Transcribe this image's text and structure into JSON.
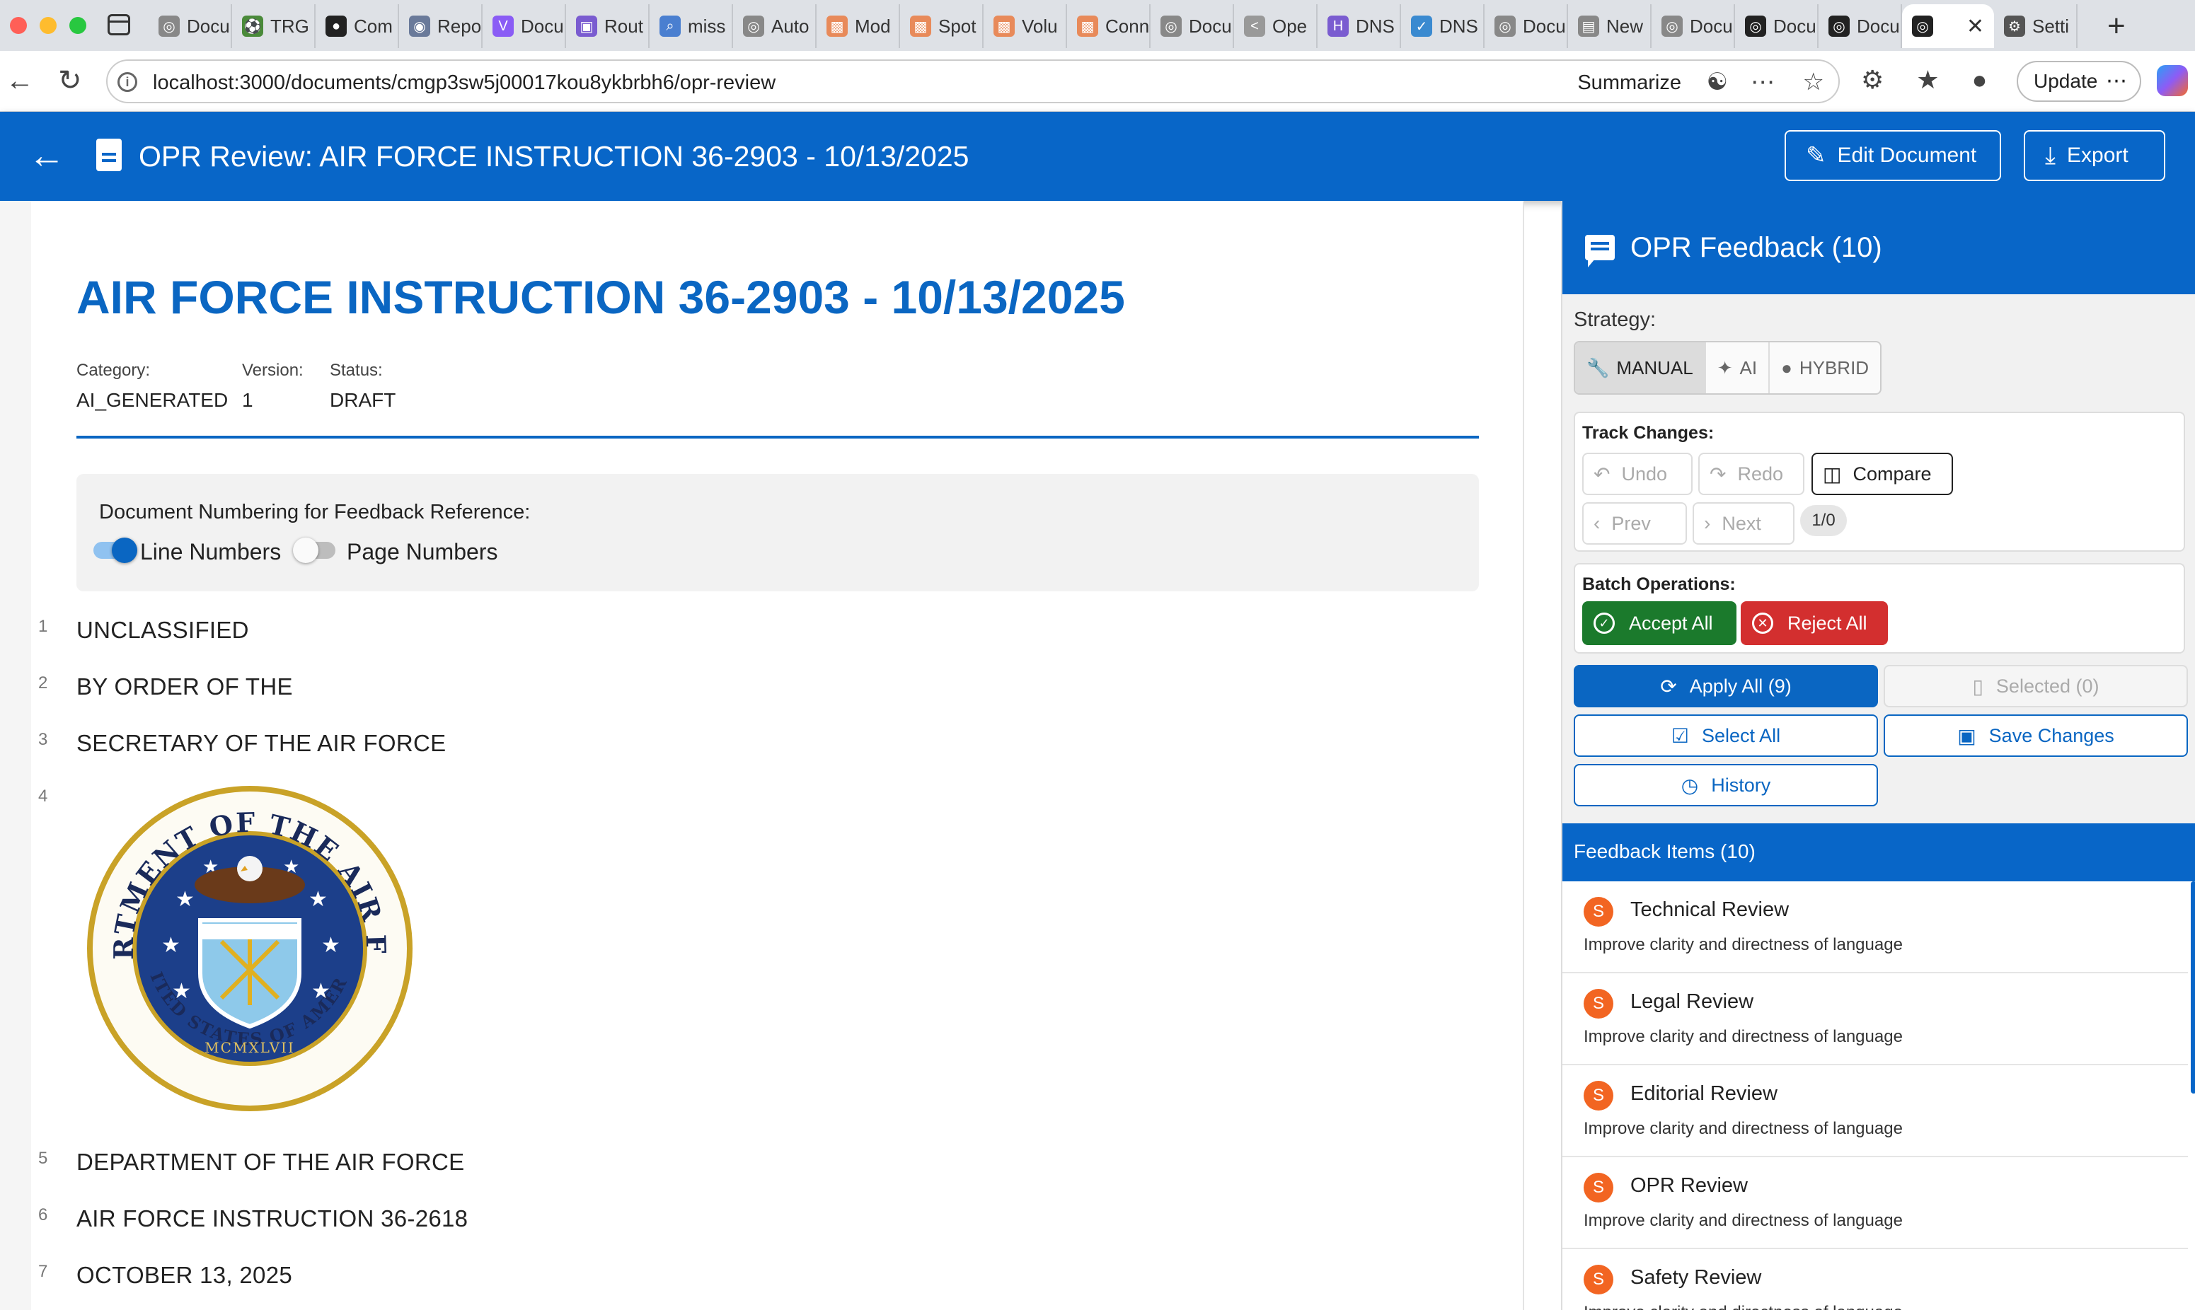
{
  "browser": {
    "tabs": [
      {
        "label": "Docu",
        "icon": "globe-icon",
        "color": "#888888"
      },
      {
        "label": "TRG",
        "icon": "soccer-icon",
        "color": "#4a8a3a"
      },
      {
        "label": "Com",
        "icon": "github-icon",
        "color": "#222222"
      },
      {
        "label": "Repo",
        "icon": "disk-icon",
        "color": "#6a7a9a"
      },
      {
        "label": "Docu",
        "icon": "v-icon",
        "color": "#8a5cf5"
      },
      {
        "label": "Rout",
        "icon": "router-icon",
        "color": "#7a5cd0"
      },
      {
        "label": "miss",
        "icon": "search-icon",
        "color": "#4a7fd0"
      },
      {
        "label": "Auto",
        "icon": "globe-icon",
        "color": "#888888"
      },
      {
        "label": "Mod",
        "icon": "orange-icon",
        "color": "#e88a5a"
      },
      {
        "label": "Spot",
        "icon": "orange-icon",
        "color": "#e88a5a"
      },
      {
        "label": "Volu",
        "icon": "orange-icon",
        "color": "#e88a5a"
      },
      {
        "label": "Conn",
        "icon": "orange-icon",
        "color": "#e88a5a"
      },
      {
        "label": "Docu",
        "icon": "globe-icon",
        "color": "#888888"
      },
      {
        "label": "Ope",
        "icon": "share-icon",
        "color": "#999999"
      },
      {
        "label": "DNS",
        "icon": "dns-icon",
        "color": "#7a5cd0"
      },
      {
        "label": "DNS",
        "icon": "check-icon",
        "color": "#3a8ad0"
      },
      {
        "label": "Docu",
        "icon": "globe-icon",
        "color": "#888888"
      },
      {
        "label": "New",
        "icon": "newtab-icon",
        "color": "#888888"
      },
      {
        "label": "Docu",
        "icon": "globe-icon",
        "color": "#888888"
      },
      {
        "label": "Docu",
        "icon": "globe-icon",
        "color": "#222222"
      },
      {
        "label": "Docu",
        "icon": "globe-icon",
        "color": "#222222"
      }
    ],
    "active_tab": {
      "icon": "globe-icon",
      "close": "✕"
    },
    "settings_tab": {
      "label": "Setti",
      "icon": "gear-icon"
    },
    "new_tab": "+",
    "url": "localhost:3000/documents/cmgp3sw5j00017kou8ykbrbh6/opr-review",
    "summarize": "Summarize",
    "update": "Update",
    "update_dots": "⋯"
  },
  "header": {
    "back": "←",
    "title": "OPR Review: AIR FORCE INSTRUCTION 36-2903 - 10/13/2025",
    "edit_button": "Edit Document",
    "edit_icon": "✎",
    "export_button": "Export",
    "export_icon": "⤓"
  },
  "document": {
    "title": "AIR FORCE INSTRUCTION 36-2903 - 10/13/2025",
    "meta": [
      {
        "label": "Category:",
        "value": "AI_GENERATED"
      },
      {
        "label": "Version:",
        "value": "1"
      },
      {
        "label": "Status:",
        "value": "DRAFT"
      }
    ],
    "numbering": {
      "heading": "Document Numbering for Feedback Reference:",
      "line_numbers": "Line Numbers",
      "line_numbers_on": true,
      "page_numbers": "Page Numbers",
      "page_numbers_on": false
    },
    "lines": [
      {
        "num": "1",
        "text": "UNCLASSIFIED"
      },
      {
        "num": "2",
        "text": "BY ORDER OF THE"
      },
      {
        "num": "3",
        "text": "SECRETARY OF THE AIR FORCE"
      },
      {
        "num": "4",
        "text": ""
      },
      {
        "num": "5",
        "text": "DEPARTMENT OF THE AIR FORCE"
      },
      {
        "num": "6",
        "text": "AIR FORCE INSTRUCTION 36-2618"
      },
      {
        "num": "7",
        "text": "OCTOBER 13, 2025"
      }
    ],
    "seal": {
      "top_text": "DEPARTMENT OF THE AIR FORCE",
      "bottom_text": "UNITED STATES OF AMERICA",
      "roman": "MCMXLVII"
    }
  },
  "panel": {
    "title": "OPR Feedback (10)",
    "strategy_label": "Strategy:",
    "strategies": [
      {
        "label": "MANUAL",
        "icon": "🔧",
        "active": true
      },
      {
        "label": "AI",
        "icon": "✦",
        "active": false
      },
      {
        "label": "HYBRID",
        "icon": "●",
        "active": false
      }
    ],
    "track_changes": {
      "label": "Track Changes:",
      "undo": "Undo",
      "redo": "Redo",
      "compare": "Compare",
      "prev": "Prev",
      "next": "Next",
      "counter": "1/0"
    },
    "batch": {
      "label": "Batch Operations:",
      "accept_all": "Accept All",
      "reject_all": "Reject All"
    },
    "actions": {
      "apply_all": "Apply All (9)",
      "selected": "Selected (0)",
      "select_all": "Select All",
      "save_changes": "Save Changes",
      "history": "History"
    },
    "items_title": "Feedback Items (10)",
    "items": [
      {
        "avatar": "S",
        "title": "Technical Review",
        "desc": "Improve clarity and directness of language"
      },
      {
        "avatar": "S",
        "title": "Legal Review",
        "desc": "Improve clarity and directness of language"
      },
      {
        "avatar": "S",
        "title": "Editorial Review",
        "desc": "Improve clarity and directness of language"
      },
      {
        "avatar": "S",
        "title": "OPR Review",
        "desc": "Improve clarity and directness of language"
      },
      {
        "avatar": "S",
        "title": "Safety Review",
        "desc": "Improve clarity and directness of language"
      }
    ]
  },
  "colors": {
    "primary": "#0866c8",
    "accept": "#1b7a2c",
    "reject": "#d32f2f",
    "avatar": "#f26522"
  }
}
